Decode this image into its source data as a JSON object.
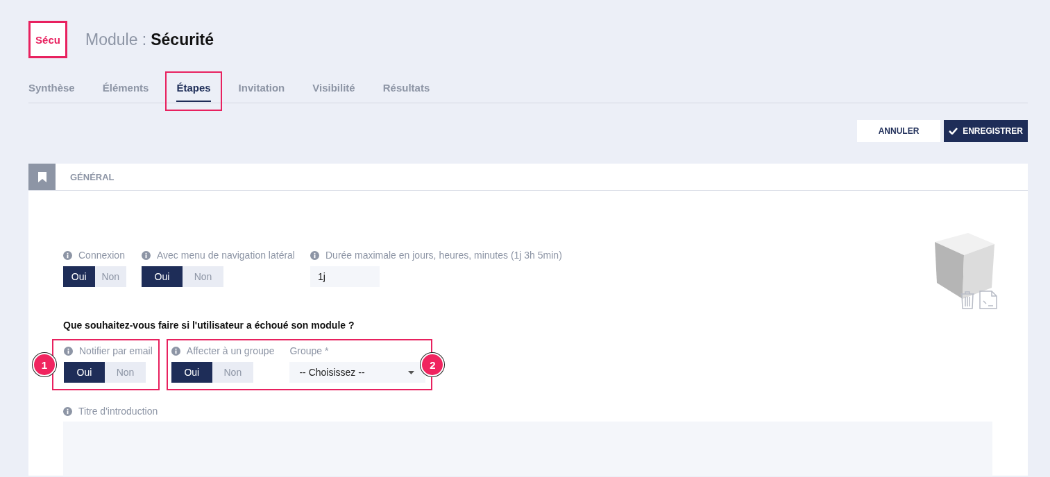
{
  "logo": {
    "text": "Sécu"
  },
  "title": {
    "prefix": "Module :",
    "name": "Sécurité"
  },
  "tabs": [
    {
      "label": "Synthèse",
      "selected": false
    },
    {
      "label": "Éléments",
      "selected": false
    },
    {
      "label": "Étapes",
      "selected": true
    },
    {
      "label": "Invitation",
      "selected": false
    },
    {
      "label": "Visibilité",
      "selected": false
    },
    {
      "label": "Résultats",
      "selected": false
    }
  ],
  "actions": [
    {
      "kind": "secondary",
      "label": "ANNULER"
    },
    {
      "kind": "primary",
      "label": "ENREGISTRER"
    }
  ],
  "section": {
    "title": "GÉNÉRAL"
  },
  "fields": [
    {
      "kind": "toggle",
      "label": "Connexion",
      "info": true,
      "options": [
        {
          "label": "Oui",
          "selected": true
        },
        {
          "label": "Non",
          "selected": false
        }
      ]
    },
    {
      "kind": "toggle",
      "label": "Avec menu de navigation latéral",
      "info": true,
      "options": [
        {
          "label": "Oui",
          "selected": true
        },
        {
          "label": "Non",
          "selected": false
        }
      ]
    },
    {
      "kind": "text",
      "label": "Durée maximale en jours, heures, minutes (1j 3h 5min)",
      "info": true,
      "value": "1j"
    }
  ],
  "question": "Que souhaitez-vous faire si l'utilisateur a échoué son module ?",
  "groups": [
    {
      "badge": "1",
      "fields": [
        {
          "kind": "toggle",
          "label": "Notifier par email",
          "info": true,
          "options": [
            {
              "label": "Oui",
              "selected": true
            },
            {
              "label": "Non",
              "selected": false
            }
          ]
        }
      ]
    },
    {
      "badge": "2",
      "fields": [
        {
          "kind": "toggle",
          "label": "Affecter à un groupe",
          "info": true,
          "options": [
            {
              "label": "Oui",
              "selected": true
            },
            {
              "label": "Non",
              "selected": false
            }
          ]
        },
        {
          "kind": "select",
          "label": "Groupe *",
          "info": false,
          "value": "-- Choisissez --"
        }
      ]
    }
  ],
  "intro": {
    "label": "Titre d'introduction",
    "info": true
  }
}
